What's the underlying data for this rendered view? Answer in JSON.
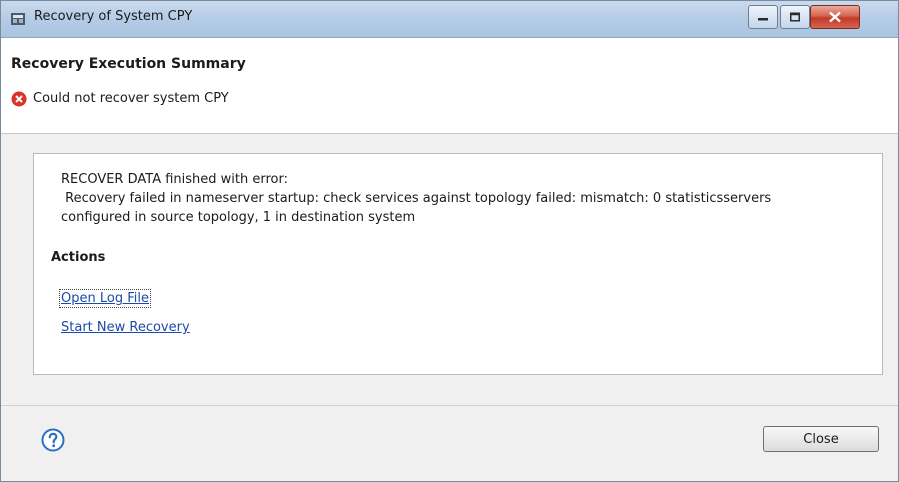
{
  "window": {
    "title": "Recovery of System CPY",
    "controls": [
      "minimize-icon",
      "maximize-icon",
      "close-icon"
    ]
  },
  "header": {
    "title": "Recovery Execution Summary",
    "status_icon": "error-icon",
    "status_text": "Could not recover system CPY"
  },
  "content": {
    "message_lines": [
      "RECOVER DATA finished with error:",
      " Recovery failed in nameserver startup: check services against topology failed: mismatch: 0 statisticsservers",
      "configured in source topology, 1 in destination system"
    ],
    "actions_heading": "Actions",
    "links": {
      "open_log": "Open Log File",
      "start_new": "Start New Recovery"
    }
  },
  "footer": {
    "help_icon": "help-icon",
    "close_label": "Close"
  },
  "colors": {
    "link": "#1a4aa8",
    "error": "#d9342b",
    "help": "#2a6fc4"
  }
}
